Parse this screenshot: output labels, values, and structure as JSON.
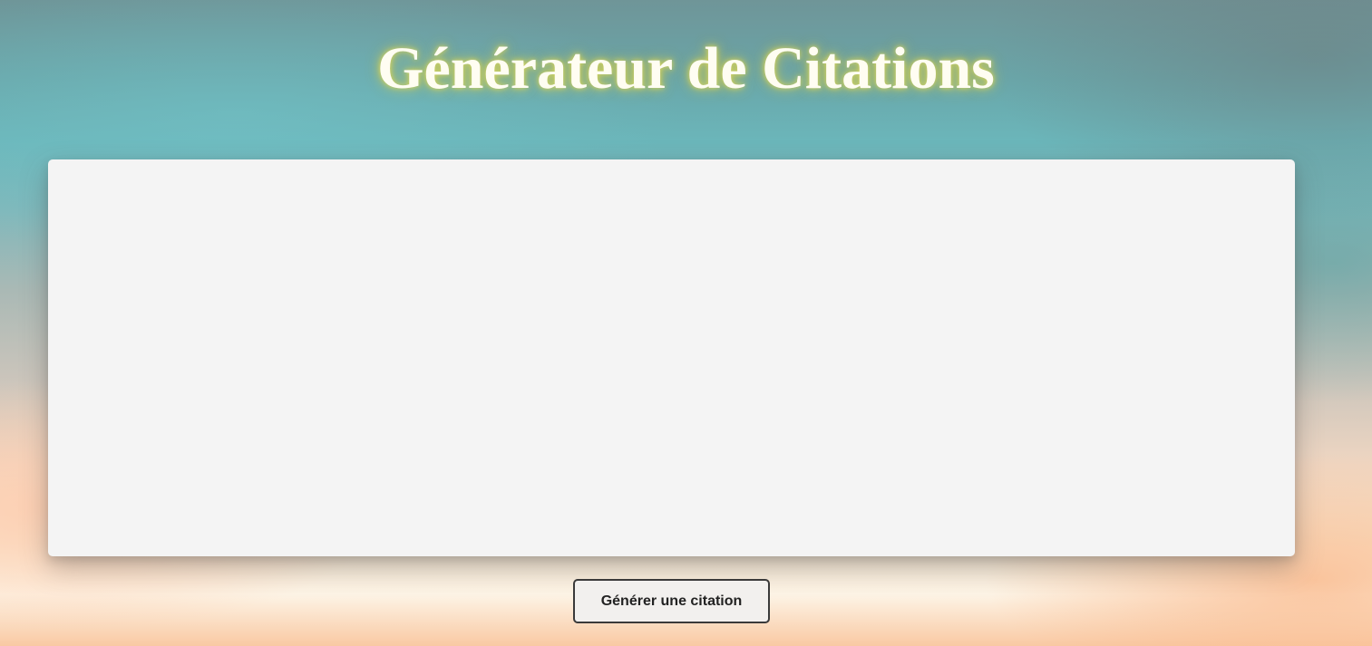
{
  "header": {
    "title": "Générateur de Citations"
  },
  "quote": {
    "text": "",
    "author": ""
  },
  "actions": {
    "generate_label": "Générer une citation"
  },
  "colors": {
    "title_text": "#fffdf2",
    "title_glow": "#d7d25a",
    "card_background": "#f4f4f4",
    "button_background": "#f2f0ee",
    "button_border": "#3a3a3a"
  }
}
